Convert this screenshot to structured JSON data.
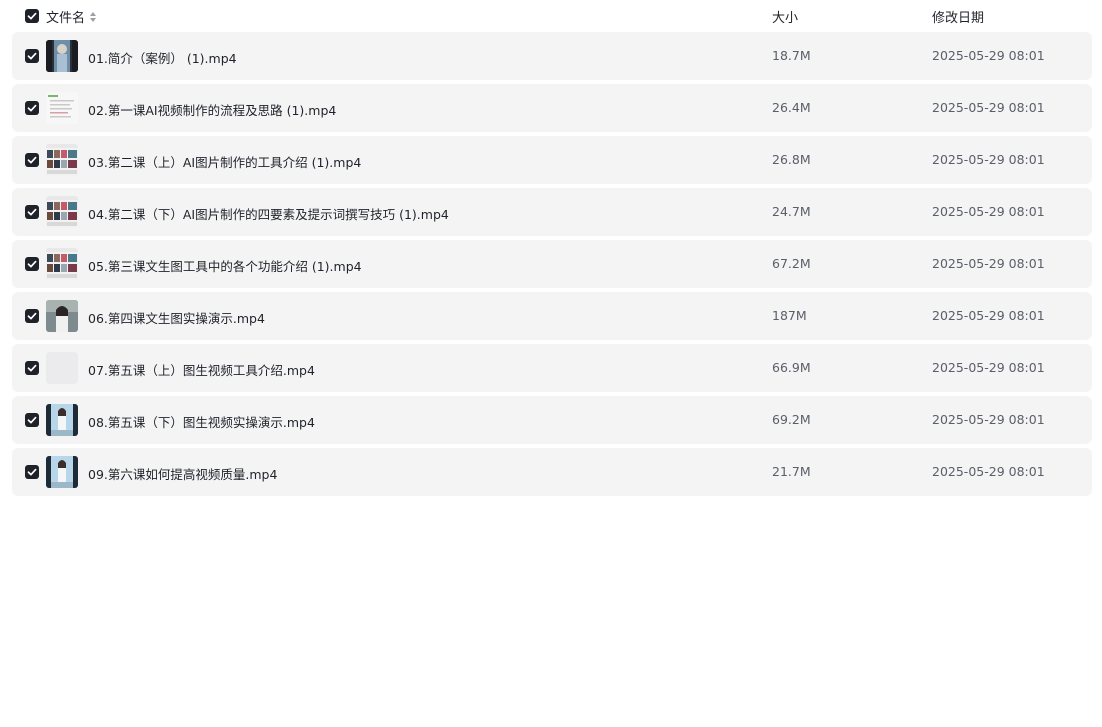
{
  "header": {
    "name_label": "文件名",
    "size_label": "大小",
    "date_label": "修改日期",
    "select_all_checked": true
  },
  "files": [
    {
      "name": "01.简介（案例） (1).mp4",
      "size": "18.7M",
      "modified": "2025-05-29 08:01",
      "checked": true,
      "thumb": "video-thumb-dark-portrait"
    },
    {
      "name": "02.第一课AI视频制作的流程及思路 (1).mp4",
      "size": "26.4M",
      "modified": "2025-05-29 08:01",
      "checked": true,
      "thumb": "video-thumb-slide"
    },
    {
      "name": "03.第二课（上）AI图片制作的工具介绍 (1).mp4",
      "size": "26.8M",
      "modified": "2025-05-29 08:01",
      "checked": true,
      "thumb": "video-thumb-gallery"
    },
    {
      "name": "04.第二课（下）AI图片制作的四要素及提示词撰写技巧 (1).mp4",
      "size": "24.7M",
      "modified": "2025-05-29 08:01",
      "checked": true,
      "thumb": "video-thumb-gallery"
    },
    {
      "name": "05.第三课文生图工具中的各个功能介绍 (1).mp4",
      "size": "67.2M",
      "modified": "2025-05-29 08:01",
      "checked": true,
      "thumb": "video-thumb-gallery"
    },
    {
      "name": "06.第四课文生图实操演示.mp4",
      "size": "187M",
      "modified": "2025-05-29 08:01",
      "checked": true,
      "thumb": "video-thumb-portrait"
    },
    {
      "name": "07.第五课（上）图生视频工具介绍.mp4",
      "size": "66.9M",
      "modified": "2025-05-29 08:01",
      "checked": true,
      "thumb": "video-thumb-placeholder"
    },
    {
      "name": "08.第五课（下）图生视频实操演示.mp4",
      "size": "69.2M",
      "modified": "2025-05-29 08:01",
      "checked": true,
      "thumb": "video-thumb-portrait-blue"
    },
    {
      "name": "09.第六课如何提高视频质量.mp4",
      "size": "21.7M",
      "modified": "2025-05-29 08:01",
      "checked": true,
      "thumb": "video-thumb-portrait-blue"
    }
  ],
  "colors": {
    "row_bg": "#f4f4f5",
    "checkbox": "#1f2329",
    "text": "#1f2329",
    "muted_text": "#5a5e66"
  }
}
